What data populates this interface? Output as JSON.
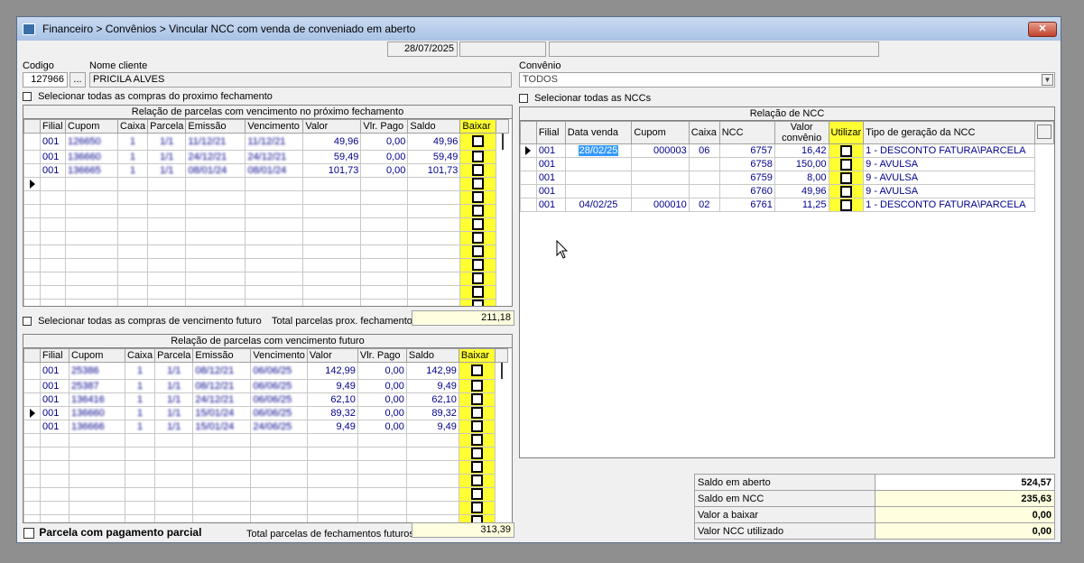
{
  "window": {
    "title": "Financeiro > Convênios > Vincular NCC com venda de conveniado em aberto",
    "close": "✕"
  },
  "date": "28/07/2025",
  "cliente": {
    "codigo_label": "Codigo",
    "codigo": "127966",
    "dots": "...",
    "nome_label": "Nome cliente",
    "nome": "PRICILA ALVES"
  },
  "convenio": {
    "label": "Convênio",
    "value": "TODOS"
  },
  "proximo": {
    "select_all": "Selecionar todas as compras do proximo fechamento",
    "caption": "Relação de parcelas com vencimento no próximo fechamento",
    "headers": [
      "Filial",
      "Cupom",
      "Caixa",
      "Parcela",
      "Emissão",
      "Vencimento",
      "Valor",
      "Vlr. Pago",
      "Saldo",
      "Baixar"
    ],
    "rows": [
      [
        "001",
        "126650",
        "1",
        "1/1",
        "11/12/21",
        "11/12/21",
        "49,96",
        "0,00",
        "49,96"
      ],
      [
        "001",
        "136660",
        "1",
        "1/1",
        "24/12/21",
        "24/12/21",
        "59,49",
        "0,00",
        "59,49"
      ],
      [
        "001",
        "136665",
        "1",
        "1/1",
        "08/01/24",
        "08/01/24",
        "101,73",
        "0,00",
        "101,73"
      ]
    ],
    "total_label": "Total parcelas prox. fechamento",
    "total": "211,18"
  },
  "futuro": {
    "select_all": "Selecionar todas as compras de vencimento futuro",
    "caption": "Relação de parcelas com vencimento futuro",
    "headers": [
      "Filial",
      "Cupom",
      "Caixa",
      "Parcela",
      "Emissão",
      "Vencimento",
      "Valor",
      "Vlr. Pago",
      "Saldo",
      "Baixar"
    ],
    "rows": [
      [
        "001",
        "25386",
        "1",
        "1/1",
        "08/12/21",
        "06/06/25",
        "142,99",
        "0,00",
        "142,99"
      ],
      [
        "001",
        "25387",
        "1",
        "1/1",
        "08/12/21",
        "06/06/25",
        "9,49",
        "0,00",
        "9,49"
      ],
      [
        "001",
        "136416",
        "1",
        "1/1",
        "24/12/21",
        "06/06/25",
        "62,10",
        "0,00",
        "62,10"
      ],
      [
        "001",
        "136660",
        "1",
        "1/1",
        "15/01/24",
        "06/06/25",
        "89,32",
        "0,00",
        "89,32"
      ],
      [
        "001",
        "136666",
        "1",
        "1/1",
        "15/01/24",
        "24/06/25",
        "9,49",
        "0,00",
        "9,49"
      ]
    ],
    "parcial_label": "Parcela com pagamento parcial",
    "total_label": "Total parcelas de fechamentos futuros",
    "total": "313,39"
  },
  "ncc": {
    "select_all": "Selecionar todas as NCCs",
    "caption": "Relação de NCC",
    "headers": [
      "Filial",
      "Data venda",
      "Cupom",
      "Caixa",
      "NCC",
      "Valor convênio",
      "Utilizar",
      "Tipo de geração da NCC"
    ],
    "rows": [
      [
        "001",
        "28/02/25",
        "000003",
        "06",
        "6757",
        "16,42",
        "1 - DESCONTO FATURA\\PARCELA"
      ],
      [
        "001",
        "",
        "",
        "",
        "6758",
        "150,00",
        "9 - AVULSA"
      ],
      [
        "001",
        "",
        "",
        "",
        "6759",
        "8,00",
        "9 - AVULSA"
      ],
      [
        "001",
        "",
        "",
        "",
        "6760",
        "49,96",
        "9 - AVULSA"
      ],
      [
        "001",
        "04/02/25",
        "000010",
        "02",
        "6761",
        "11,25",
        "1 - DESCONTO FATURA\\PARCELA"
      ]
    ]
  },
  "summary": [
    {
      "label": "Saldo em aberto",
      "value": "524,57"
    },
    {
      "label": "Saldo em NCC",
      "value": "235,63"
    },
    {
      "label": "Valor a baixar",
      "value": "0,00"
    },
    {
      "label": "Valor NCC utilizado",
      "value": "0,00"
    }
  ],
  "colors": {
    "accent_yellow": "#ffff33",
    "link_blue": "#00008b"
  }
}
